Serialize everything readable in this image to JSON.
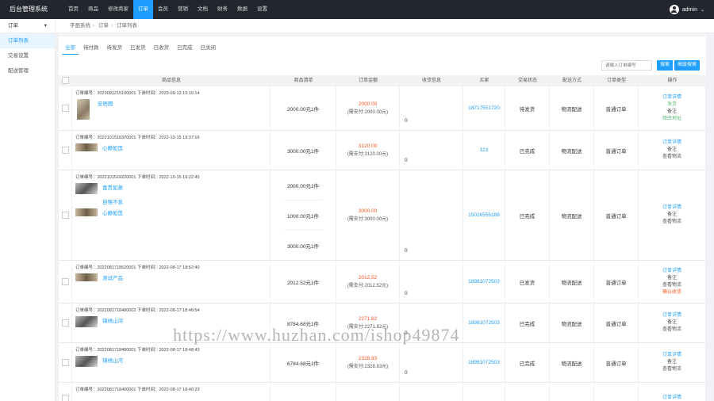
{
  "app": {
    "logo": "后台管理系统"
  },
  "nav": [
    {
      "label": "首页"
    },
    {
      "label": "商品"
    },
    {
      "label": "修改商家"
    },
    {
      "label": "订单"
    },
    {
      "label": "会员"
    },
    {
      "label": "营销"
    },
    {
      "label": "文档"
    },
    {
      "label": "财务"
    },
    {
      "label": "数据"
    },
    {
      "label": "设置"
    }
  ],
  "user": {
    "name": "admin",
    "caret": "⌄"
  },
  "sidebar": {
    "header": "订单",
    "header_caret": "▾",
    "items": [
      {
        "label": "订单列表"
      },
      {
        "label": "交易设置"
      },
      {
        "label": "配送管理"
      }
    ]
  },
  "breadcrumb": [
    "字画系统",
    "订单",
    "订单列表"
  ],
  "tabs": [
    {
      "label": "全部"
    },
    {
      "label": "待付款"
    },
    {
      "label": "待发货"
    },
    {
      "label": "已发货"
    },
    {
      "label": "已收货"
    },
    {
      "label": "已完成"
    },
    {
      "label": "已关闭"
    }
  ],
  "search": {
    "placeholder": "请输入订单编号",
    "search_btn": "搜索",
    "adv_btn": "高级搜索"
  },
  "columns": [
    "商品信息",
    "商品清单",
    "订单金额",
    "收货信息",
    "买家",
    "交易状态",
    "配送方式",
    "订单类型",
    "操作"
  ],
  "orders": [
    {
      "head": "订单编号：2023091215100001 下单时间：2023-09-12 15:10:14",
      "products": [
        {
          "name": "安居图",
          "thumb": "tall",
          "price": "2000.00元",
          "qty": "1件"
        }
      ],
      "amount": "2000.00",
      "paid": "(需支付:2000.00元)",
      "recv": "0",
      "buyer": "18717551720",
      "status": "待发货",
      "ship": "物流配送",
      "type": "普通订单",
      "ops": [
        {
          "t": "订单详情",
          "c": "blue"
        },
        {
          "t": "发货",
          "c": "green"
        },
        {
          "t": "备注",
          "c": ""
        },
        {
          "t": "修改地址",
          "c": "green"
        }
      ]
    },
    {
      "head": "订单编号：2022101519370001 下单时间：2022-10-15 19:37:16",
      "products": [
        {
          "name": "心静如莲",
          "thumb": "wide",
          "price": "3000.00元",
          "qty": "1件"
        }
      ],
      "amount": "3120.00",
      "paid": "(需支付:3120.00元)",
      "recv": "0",
      "buyer": "123",
      "status": "已完成",
      "ship": "物流配送",
      "type": "普通订单",
      "ops": [
        {
          "t": "订单详情",
          "c": "blue"
        },
        {
          "t": "备注",
          "c": ""
        },
        {
          "t": "查看物流",
          "c": ""
        }
      ]
    },
    {
      "head": "订单编号：2022101519220001 下单时间：2022-10-15 19:22:45",
      "products": [
        {
          "name": "富贵如意",
          "thumb": "ink",
          "price": "2000.00元",
          "qty": "1件"
        },
        {
          "name": "自强不息",
          "thumb": "none",
          "price": "1000.00元",
          "qty": "1件"
        },
        {
          "name": "心静如莲",
          "thumb": "wide",
          "price": "3000.00元",
          "qty": "1件"
        }
      ],
      "amount": "3000.00",
      "paid": "(需支付:3000.00元)",
      "recv": "0",
      "buyer": "15026555188",
      "status": "已完成",
      "ship": "物流配送",
      "type": "普通订单",
      "ops": [
        {
          "t": "订单详情",
          "c": "blue"
        },
        {
          "t": "备注",
          "c": ""
        },
        {
          "t": "查看物流",
          "c": ""
        }
      ]
    },
    {
      "head": "订单编号：2022081718520001 下单时间：2022-08-17 18:52:40",
      "products": [
        {
          "name": "测试产品",
          "thumb": "wide",
          "price": "2012.52元",
          "qty": "1件"
        }
      ],
      "amount": "2012.52",
      "paid": "(需支付:2012.52元)",
      "recv": "0",
      "buyer": "18981072503",
      "status": "已发货",
      "ship": "物流配送",
      "type": "普通订单",
      "ops": [
        {
          "t": "订单详情",
          "c": "blue"
        },
        {
          "t": "备注",
          "c": ""
        },
        {
          "t": "查看物流",
          "c": ""
        },
        {
          "t": "确认收货",
          "c": "orange"
        }
      ]
    },
    {
      "head": "订单编号：2022081718480002 下单时间：2022-08-17 18:48:54",
      "products": [
        {
          "name": "锦绣山河",
          "thumb": "ink",
          "price": "8784.68元",
          "qty": "1件"
        }
      ],
      "amount": "2271.82",
      "paid": "(需支付:2271.82元)",
      "recv": "0",
      "buyer": "18981072503",
      "status": "已完成",
      "ship": "物流配送",
      "type": "普通订单",
      "ops": [
        {
          "t": "订单详情",
          "c": "blue"
        },
        {
          "t": "备注",
          "c": ""
        },
        {
          "t": "查看物流",
          "c": ""
        }
      ]
    },
    {
      "head": "订单编号：2022081718480001 下单时间：2022-08-17 18:48:43",
      "products": [
        {
          "name": "锦绣山河",
          "thumb": "ink",
          "price": "6784.68元",
          "qty": "1件"
        }
      ],
      "amount": "2328.83",
      "paid": "(需支付:2328.83元)",
      "recv": "0",
      "buyer": "18981072503",
      "status": "已完成",
      "ship": "物流配送",
      "type": "普通订单",
      "ops": [
        {
          "t": "订单详情",
          "c": "blue"
        },
        {
          "t": "备注",
          "c": ""
        },
        {
          "t": "查看物流",
          "c": ""
        }
      ]
    },
    {
      "head": "订单编号：2022081718400001 下单时间：2022-08-17 18:40:23",
      "products": [],
      "amount": "",
      "paid": "",
      "recv": "",
      "buyer": "",
      "status": "",
      "ship": "",
      "type": "",
      "ops": [
        {
          "t": "订单详情",
          "c": "blue"
        }
      ]
    }
  ],
  "watermark": "https://www.huzhan.com/ishop49874"
}
